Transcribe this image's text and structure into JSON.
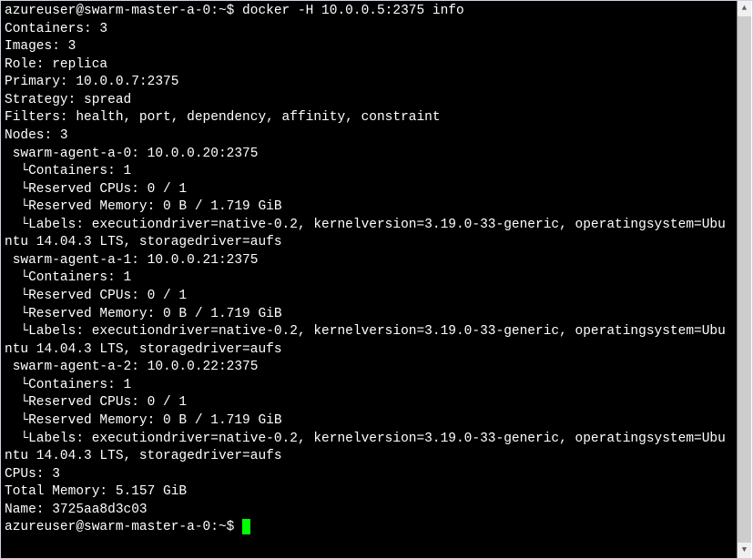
{
  "prompt": "azureuser@swarm-master-a-0:~$",
  "command": "docker -H 10.0.0.5:2375 info",
  "output": {
    "containers": "Containers: 3",
    "images": "Images: 3",
    "role": "Role: replica",
    "primary": "Primary: 10.0.0.7:2375",
    "strategy": "Strategy: spread",
    "filters": "Filters: health, port, dependency, affinity, constraint",
    "nodes_header": "Nodes: 3",
    "nodes": [
      {
        "name": "swarm-agent-a-0: 10.0.0.20:2375",
        "containers": "Containers: 1",
        "cpus": "Reserved CPUs: 0 / 1",
        "mem": "Reserved Memory: 0 B / 1.719 GiB",
        "labels": "Labels: executiondriver=native-0.2, kernelversion=3.19.0-33-generic, operatingsystem=Ubuntu 14.04.3 LTS, storagedriver=aufs"
      },
      {
        "name": "swarm-agent-a-1: 10.0.0.21:2375",
        "containers": "Containers: 1",
        "cpus": "Reserved CPUs: 0 / 1",
        "mem": "Reserved Memory: 0 B / 1.719 GiB",
        "labels": "Labels: executiondriver=native-0.2, kernelversion=3.19.0-33-generic, operatingsystem=Ubuntu 14.04.3 LTS, storagedriver=aufs"
      },
      {
        "name": "swarm-agent-a-2: 10.0.0.22:2375",
        "containers": "Containers: 1",
        "cpus": "Reserved CPUs: 0 / 1",
        "mem": "Reserved Memory: 0 B / 1.719 GiB",
        "labels": "Labels: executiondriver=native-0.2, kernelversion=3.19.0-33-generic, operatingsystem=Ubuntu 14.04.3 LTS, storagedriver=aufs"
      }
    ],
    "cpus": "CPUs: 3",
    "total_memory": "Total Memory: 5.157 GiB",
    "name": "Name: 3725aa8d3c03"
  },
  "prompt2": "azureuser@swarm-master-a-0:~$ "
}
